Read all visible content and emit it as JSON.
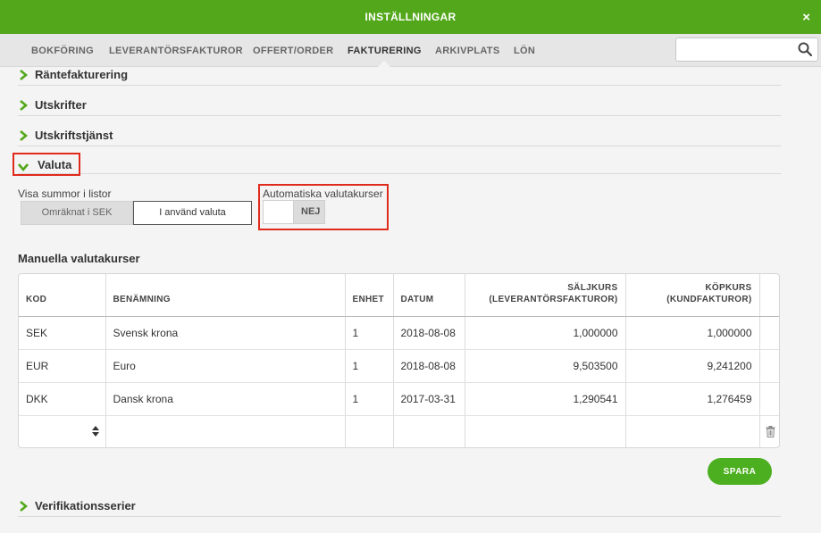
{
  "window": {
    "title": "INSTÄLLNINGAR",
    "close_icon": "×"
  },
  "nav": {
    "tabs": [
      {
        "label": "BOKFÖRING"
      },
      {
        "label": "LEVERANTÖRSFAKTUROR"
      },
      {
        "label": "OFFERT/ORDER"
      },
      {
        "label": "FAKTURERING"
      },
      {
        "label": "ARKIVPLATS"
      },
      {
        "label": "LÖN"
      }
    ],
    "active_tab": "FAKTURERING",
    "search": {
      "placeholder": "",
      "value": ""
    }
  },
  "sections": {
    "rantefakturering": "Räntefakturering",
    "utskrifter": "Utskrifter",
    "utskriftstjanst": "Utskriftstjänst",
    "valuta": "Valuta",
    "verifikationsserier": "Verifikationsserier"
  },
  "valuta": {
    "visa_summor_label": "Visa summor i listor",
    "option_sek": "Omräknat i SEK",
    "option_valuta": "I använd valuta",
    "selected_option": "I använd valuta",
    "auto_label": "Automatiska valutakurser",
    "auto_state": "NEJ",
    "manual_heading": "Manuella valutakurser"
  },
  "table": {
    "headers": {
      "kod": "KOD",
      "benamning": "BENÄMNING",
      "enhet": "ENHET",
      "datum": "DATUM",
      "saljkurs_1": "SÄLJKURS",
      "saljkurs_2": "(LEVERANTÖRSFAKTUROR)",
      "kopkurs_1": "KÖPKURS",
      "kopkurs_2": "(KUNDFAKTUROR)"
    },
    "rows": [
      {
        "kod": "SEK",
        "benamning": "Svensk krona",
        "enhet": "1",
        "datum": "2018-08-08",
        "saljkurs": "1,000000",
        "kopkurs": "1,000000"
      },
      {
        "kod": "EUR",
        "benamning": "Euro",
        "enhet": "1",
        "datum": "2018-08-08",
        "saljkurs": "9,503500",
        "kopkurs": "9,241200"
      },
      {
        "kod": "DKK",
        "benamning": "Dansk krona",
        "enhet": "1",
        "datum": "2017-03-31",
        "saljkurs": "1,290541",
        "kopkurs": "1,276459"
      }
    ]
  },
  "buttons": {
    "save": "SPARA"
  },
  "icons": {
    "search": "search-icon",
    "close": "close-icon",
    "chevron_right": "chevron-right-icon",
    "chevron_down": "chevron-down-icon",
    "select_arrows": "updown-arrows-icon",
    "trash": "trash-icon"
  },
  "colors": {
    "accent": "#53a71b",
    "highlight": "#e02a1c"
  }
}
